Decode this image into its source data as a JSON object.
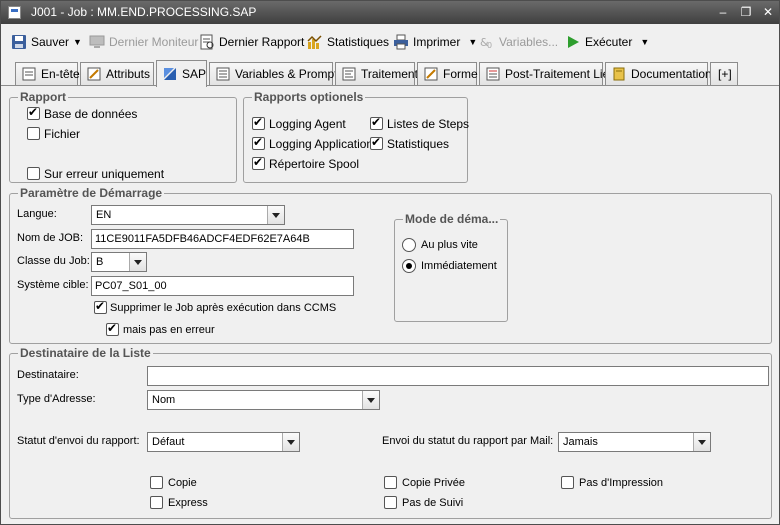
{
  "window": {
    "title": "J001 - Job : MM.END.PROCESSING.SAP",
    "minimize": "–",
    "restore": "❐",
    "close": "✕"
  },
  "toolbar": {
    "save": "Sauver",
    "last_monitor": "Dernier Moniteur",
    "last_report": "Dernier Rapport",
    "statistics": "Statistiques",
    "print": "Imprimer",
    "variables": "Variables...",
    "execute": "Exécuter"
  },
  "tabs": [
    {
      "label": "En-tête"
    },
    {
      "label": "Attributs"
    },
    {
      "label": "SAP"
    },
    {
      "label": "Variables & Prompts"
    },
    {
      "label": "Traitement"
    },
    {
      "label": "Forme"
    },
    {
      "label": "Post-Traitement Lié"
    },
    {
      "label": "Documentation"
    },
    {
      "label": "[+]"
    }
  ],
  "rapport": {
    "title": "Rapport",
    "database": {
      "label": "Base de données",
      "checked": true
    },
    "file": {
      "label": "Fichier",
      "checked": false
    },
    "on_error_only": {
      "label": "Sur erreur uniquement",
      "checked": false
    }
  },
  "optional_reports": {
    "title": "Rapports optionels",
    "logging_agent": {
      "label": "Logging Agent",
      "checked": true
    },
    "step_lists": {
      "label": "Listes de Steps",
      "checked": true
    },
    "logging_application": {
      "label": "Logging Application",
      "checked": true
    },
    "statistics": {
      "label": "Statistiques",
      "checked": true
    },
    "spool_directory": {
      "label": "Répertoire Spool",
      "checked": true
    }
  },
  "start_params": {
    "title": "Paramètre de Démarrage",
    "language_label": "Langue:",
    "language_value": "EN",
    "job_name_label": "Nom de JOB:",
    "job_name_value": "11CE9011FA5DFB46ADCF4EDF62E7A64B",
    "job_class_label": "Classe du Job:",
    "job_class_value": "B",
    "target_system_label": "Système cible:",
    "target_system_value": "PC07_S01_00",
    "delete_job": {
      "label": "Supprimer le Job après exécution dans CCMS",
      "checked": true
    },
    "not_on_error": {
      "label": "mais pas en erreur",
      "checked": true
    }
  },
  "start_mode": {
    "title": "Mode de déma...",
    "asap": {
      "label": "Au plus vite",
      "selected": false
    },
    "immediate": {
      "label": "Immédiatement",
      "selected": true
    }
  },
  "recipient": {
    "title": "Destinataire de la Liste",
    "recipient_label": "Destinataire:",
    "recipient_value": "",
    "address_type_label": "Type d'Adresse:",
    "address_type_value": "Nom",
    "report_status_label": "Statut d'envoi du rapport:",
    "report_status_value": "Défaut",
    "mail_status_label": "Envoi du statut du rapport par Mail:",
    "mail_status_value": "Jamais",
    "copy": {
      "label": "Copie",
      "checked": false
    },
    "private_copy": {
      "label": "Copie Privée",
      "checked": false
    },
    "no_print": {
      "label": "Pas d'Impression",
      "checked": false
    },
    "express": {
      "label": "Express",
      "checked": false
    },
    "no_tracking": {
      "label": "Pas de Suivi",
      "checked": false
    }
  },
  "colors": {
    "title_bar": "#4f4f4f",
    "toolbar_bg": "#f0f0f0",
    "sap_tab_icon": "#2a5fb0",
    "execute_icon": "#2e9e2e"
  }
}
